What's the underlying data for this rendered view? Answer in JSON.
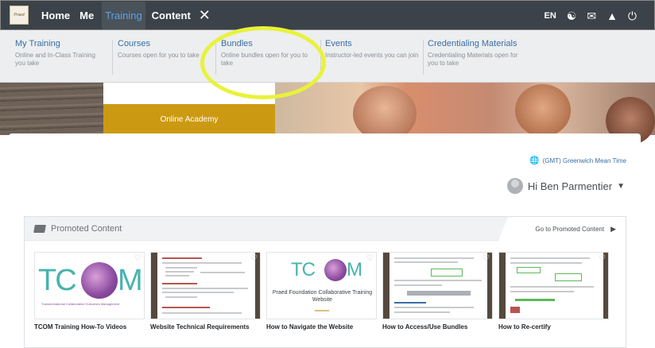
{
  "topnav": {
    "logo_text": "Praed",
    "items": [
      {
        "label": "Home"
      },
      {
        "label": "Me"
      },
      {
        "label": "Training"
      },
      {
        "label": "Content"
      }
    ],
    "language": "EN",
    "icons": [
      "people-icon",
      "mail-icon",
      "bell-icon",
      "power-icon"
    ]
  },
  "dropdown": {
    "items": [
      {
        "title": "My Training",
        "desc": "Online and In-Class Training you take"
      },
      {
        "title": "Courses",
        "desc": "Courses open for you to take"
      },
      {
        "title": "Bundles",
        "desc": "Online bundles open for you to take"
      },
      {
        "title": "Events",
        "desc": "Instructor-led events you can join"
      },
      {
        "title": "Credentialing Materials",
        "desc": "Credentialing Materials open for you to take"
      }
    ]
  },
  "banner": {
    "academy_label": "Online Academy"
  },
  "panel": {
    "timezone": "(GMT) Greenwich Mean Time",
    "greeting": "Hi Ben Parmentier"
  },
  "promoted": {
    "title": "Promoted Content",
    "goto_label": "Go to Promoted Content",
    "cards": [
      {
        "label": "TCOM Training How-To Videos"
      },
      {
        "label": "Website Technical Requirements"
      },
      {
        "label": "How to Navigate the Website"
      },
      {
        "label": "How to Access/Use Bundles"
      },
      {
        "label": "How to Re-certify"
      }
    ],
    "tcom_logo_text": "TC",
    "tcom_logo_text_end": "M",
    "tcom_sub": "Transformational Collaborative Outcomes Management",
    "navigate_caption": "Praed Foundation Collaborative Training Website"
  },
  "colors": {
    "topbar": "#3b4249",
    "accent": "#3a6ea5",
    "academy": "#cc9a12",
    "highlight": "#e9f23a"
  }
}
